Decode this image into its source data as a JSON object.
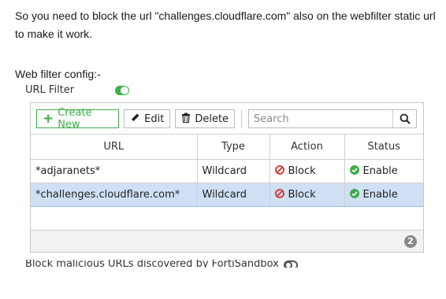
{
  "intro": {
    "text": "So you need to block the url \"challenges.cloudflare.com\" also on the webfilter static url to make it work."
  },
  "config_title": "Web filter config:-",
  "url_filter": {
    "label": "URL Filter",
    "enabled": true
  },
  "toolbar": {
    "create_label": "Create New",
    "edit_label": "Edit",
    "delete_label": "Delete",
    "search_placeholder": "Search"
  },
  "table": {
    "columns": [
      "URL",
      "Type",
      "Action",
      "Status"
    ],
    "rows": [
      {
        "url": "*adjaranets*",
        "type": "Wildcard",
        "action": "Block",
        "status": "Enable",
        "selected": false
      },
      {
        "url": "*challenges.cloudflare.com*",
        "type": "Wildcard",
        "action": "Block",
        "status": "Enable",
        "selected": true
      }
    ],
    "count": "2"
  },
  "sandbox": {
    "label": "Block malicious URLs discovered by FortiSandbox",
    "enabled": false
  },
  "colors": {
    "accent_green": "#3fae49",
    "block_red": "#d93025",
    "selected_row": "#cfe0f5"
  }
}
